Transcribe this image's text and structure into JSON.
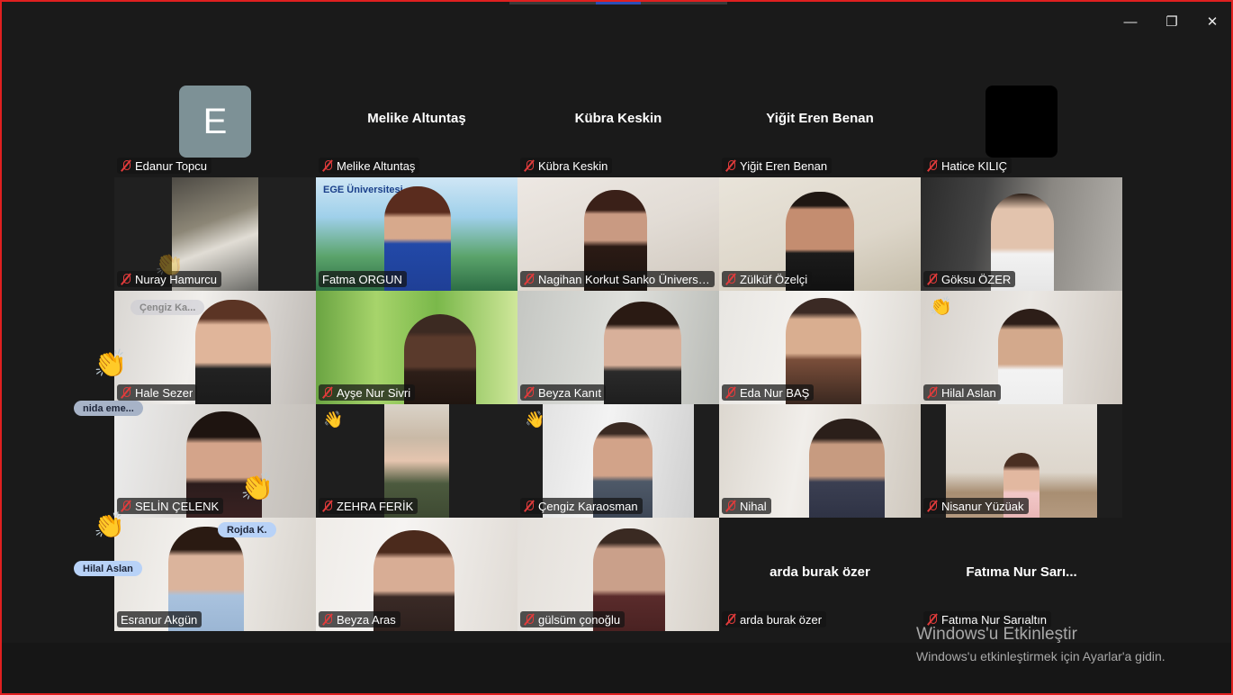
{
  "window": {
    "controls": {
      "minimize": "—",
      "restore": "❐",
      "close": "✕"
    }
  },
  "tiles": {
    "edanur": {
      "name": "Edanur Topcu",
      "avatar_letter": "E"
    },
    "melike": {
      "name": "Melike Altuntaş",
      "display": "Melike Altuntaş"
    },
    "kubra": {
      "name": "Kübra Keskin",
      "display": "Kübra Keskin"
    },
    "yigit": {
      "name": "Yiğit Eren Benan",
      "display": "Yiğit Eren Benan"
    },
    "hatice": {
      "name": "Hatice KILIÇ"
    },
    "nuray": {
      "name": "Nuray Hamurcu"
    },
    "fatma": {
      "name": "Fatma ORGUN",
      "bg_text": "EGE Üniversitesi"
    },
    "nagihan": {
      "name": "Nagihan Korkut Sanko Üniversit..."
    },
    "zulkuf": {
      "name": "Zülküf Özelçi"
    },
    "goksu": {
      "name": "Göksu ÖZER"
    },
    "hale": {
      "name": "Hale Sezer"
    },
    "ayse": {
      "name": "Ayşe Nur Sivri"
    },
    "beyza_k": {
      "name": "Beyza Kanıt"
    },
    "eda": {
      "name": "Eda Nur BAŞ"
    },
    "hilal": {
      "name": "Hilal Aslan"
    },
    "selin": {
      "name": "SELİN ÇELENK"
    },
    "zehra": {
      "name": "ZEHRA FERİK"
    },
    "cengiz": {
      "name": "Çengiz Karaosman"
    },
    "nihal": {
      "name": "Nihal"
    },
    "nisanur": {
      "name": "Nisanur Yüzüak"
    },
    "esranur": {
      "name": "Esranur Akgün"
    },
    "beyza_a": {
      "name": "Beyza Aras"
    },
    "gulsum": {
      "name": "gülsüm çonoğlu"
    },
    "arda": {
      "name": "arda burak özer",
      "display": "arda burak özer"
    },
    "fatima": {
      "name": "Fatıma Nur Sarıaltın",
      "display": "Fatıma Nur Sarı..."
    }
  },
  "reactions": {
    "cengiz_pill": "Çengiz Ka...",
    "nida_pill": "nida eme...",
    "rojda_pill": "Rojda K.",
    "hilal_pill": "Hilal Aslan",
    "hand_glyph": "👏",
    "wave_glyph": "👋"
  },
  "watermark": {
    "title": "Windows'u Etkinleştir",
    "subtitle": "Windows'u etkinleştirmek için Ayarlar'a gidin."
  },
  "colors": {
    "background": "#1a1a1a",
    "active_speaker": "#2fd07a",
    "mute_red": "#e23b3b",
    "window_border": "#e02020"
  }
}
